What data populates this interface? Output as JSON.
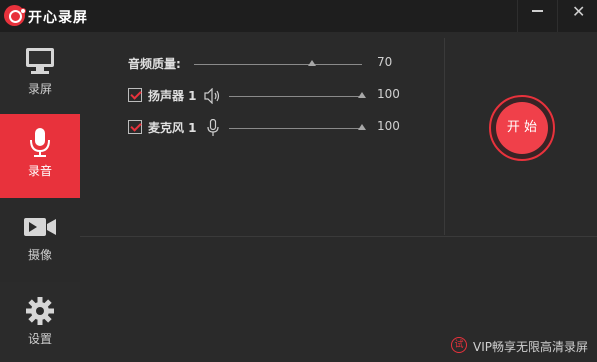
{
  "app": {
    "title": "开心录屏"
  },
  "window": {
    "minimize_icon": "minimize-icon",
    "close_glyph": "✕"
  },
  "sidebar": {
    "items": [
      {
        "id": "record",
        "label": "录屏",
        "icon": "monitor-icon",
        "active": false
      },
      {
        "id": "audio",
        "label": "录音",
        "icon": "microphone-icon",
        "active": true
      },
      {
        "id": "camera",
        "label": "摄像",
        "icon": "camera-icon",
        "active": false
      },
      {
        "id": "settings",
        "label": "设置",
        "icon": "gear-icon",
        "active": false
      }
    ]
  },
  "audio_panel": {
    "quality": {
      "label": "音频质量:",
      "value": "70",
      "level": 70
    },
    "speaker": {
      "label": "扬声器 1",
      "checked": true,
      "value": "100",
      "level": 100,
      "icon": "speaker-icon"
    },
    "microphone": {
      "label": "麦克风 1",
      "checked": true,
      "value": "100",
      "level": 100,
      "icon": "microphone-icon"
    }
  },
  "start_button": {
    "label": "开 始"
  },
  "vip": {
    "icon_text": "试",
    "text": "VIP畅享无限高清录屏"
  },
  "colors": {
    "accent": "#e8323c",
    "background": "#2a2a2a",
    "titlebar": "#1e1e1e",
    "sidebar": "#303030"
  }
}
